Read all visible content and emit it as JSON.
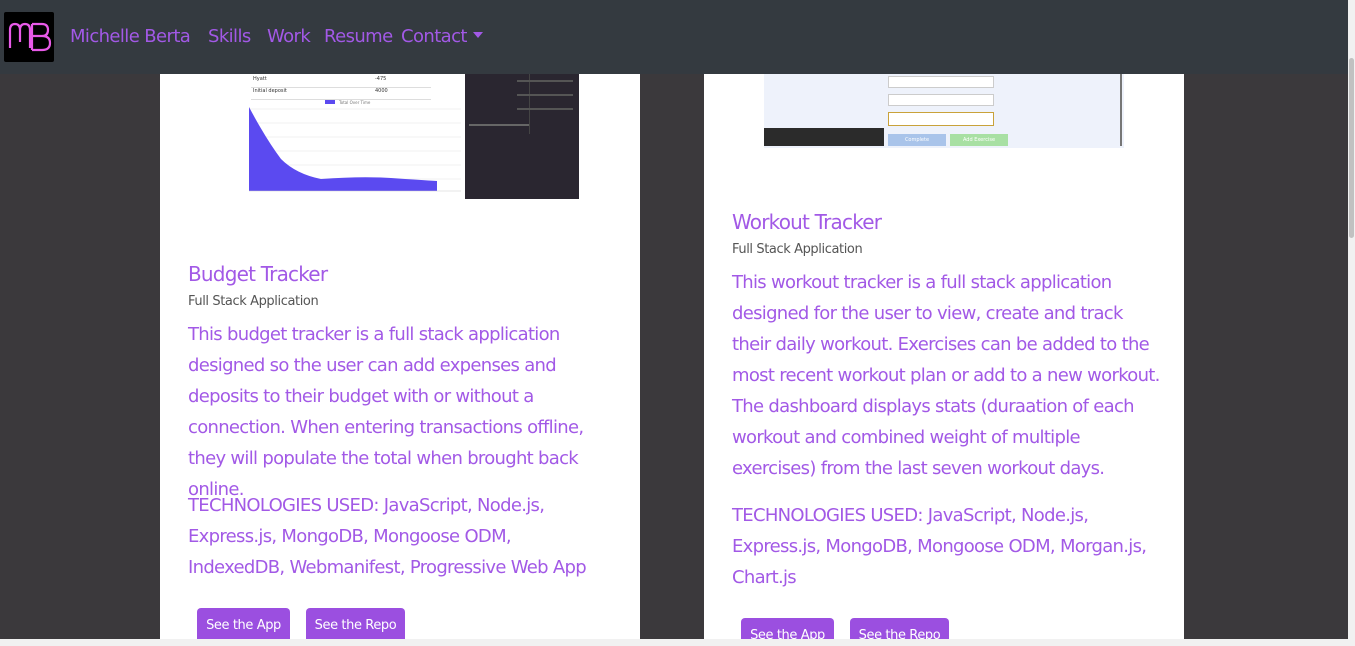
{
  "nav": {
    "logo_text": "MB",
    "brand": "Michelle Berta",
    "links": [
      "Skills",
      "Work",
      "Resume",
      "Contact"
    ]
  },
  "colors": {
    "accent": "#a259e6",
    "button": "#9b4fe0",
    "navbar": "#343a40",
    "page_bg": "#3b393c"
  },
  "projects": [
    {
      "title": "Budget Tracker",
      "subtitle": "Full Stack Application",
      "description": "This budget tracker is a full stack application designed so the user can add expenses and deposits to their budget with or without a connection. When entering transactions offline, they will populate the total when brought back online.",
      "technologies": "TECHNOLOGIES USED: JavaScript, Node.js, Express.js, MongoDB, Mongoose ODM, IndexedDB, Webmanifest, Progressive Web App",
      "app_label": "See the App",
      "repo_label": "See the Repo",
      "screenshot": {
        "rows": [
          [
            "Hyatt",
            "-475"
          ],
          [
            "Initial deposit",
            "4000"
          ]
        ],
        "legend": "Total Over Time"
      }
    },
    {
      "title": "Workout Tracker",
      "subtitle": "Full Stack Application",
      "description": "This workout tracker is a full stack application designed for the user to view, create and track their daily workout. Exercises can be added to the most recent workout plan or add to a new workout. The dashboard displays stats (duraation of each workout and combined weight of multiple exercises) from the last seven workout days.",
      "technologies": "TECHNOLOGIES USED: JavaScript, Node.js, Express.js, MongoDB, Mongoose ODM, Morgan.js, Chart.js",
      "app_label": "See the App",
      "repo_label": "See the Repo",
      "screenshot": {
        "complete_label": "Complete",
        "add_label": "Add Exercise"
      }
    }
  ]
}
